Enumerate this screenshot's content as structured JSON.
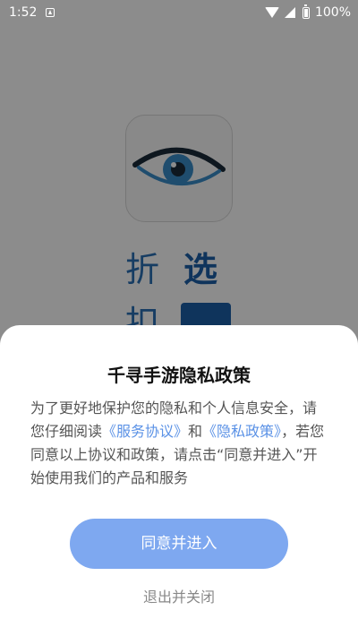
{
  "status_bar": {
    "time": "1:52",
    "battery": "100%"
  },
  "background_app": {
    "brand_char_1": "折",
    "brand_char_2": "选",
    "brand_char_3": "扣"
  },
  "dialog": {
    "title": "千寻手游隐私政策",
    "body_part1": "为了更好地保护您的隐私和个人信息安全，请您仔细阅读",
    "link_service": "《服务协议》",
    "body_part2": "和",
    "link_privacy": "《隐私政策》",
    "body_part3": "，若您同意以上协议和政策，请点击“同意并进入”开始使用我们的产品和服务",
    "agree_label": "同意并进入",
    "exit_label": "退出并关闭"
  },
  "colors": {
    "accent": "#7ea8f0",
    "link": "#5b92e6",
    "brand_blue": "#1d5fa8"
  },
  "icons": [
    "notification-icon",
    "wifi-icon",
    "signal-icon",
    "battery-icon",
    "eye-logo-icon"
  ]
}
